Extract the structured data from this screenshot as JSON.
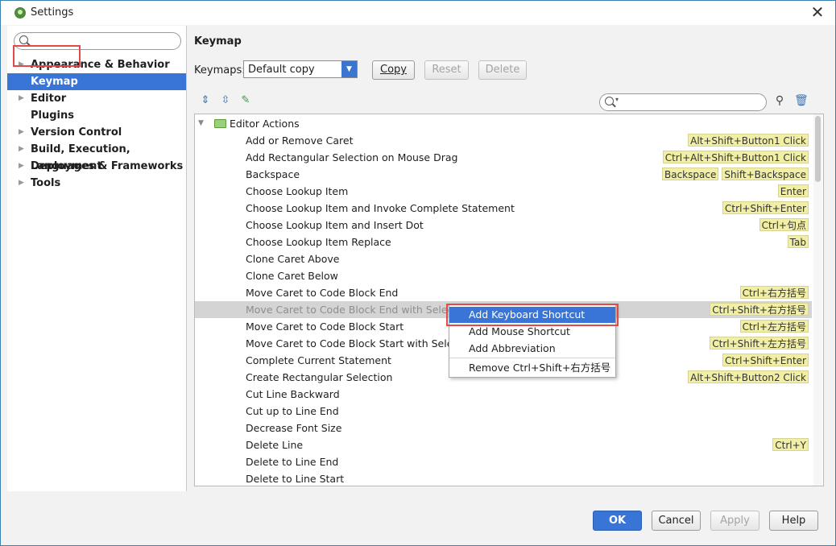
{
  "window": {
    "title": "Settings",
    "close_glyph": "✕"
  },
  "sidebar": {
    "search_placeholder": "",
    "items": [
      {
        "label": "Appearance & Behavior",
        "expandable": true
      },
      {
        "label": "Keymap",
        "expandable": false,
        "selected": true
      },
      {
        "label": "Editor",
        "expandable": true
      },
      {
        "label": "Plugins",
        "expandable": false
      },
      {
        "label": "Version Control",
        "expandable": true
      },
      {
        "label": "Build, Execution, Deployment",
        "expandable": true
      },
      {
        "label": "Languages & Frameworks",
        "expandable": true
      },
      {
        "label": "Tools",
        "expandable": true
      }
    ]
  },
  "main": {
    "heading": "Keymap",
    "keymaps_label": "Keymaps:",
    "keymap_value": "Default copy",
    "copy_label": "Copy",
    "reset_label": "Reset",
    "delete_label": "Delete",
    "search_placeholder": "",
    "tree": {
      "root_label": "Editor Actions",
      "rows": [
        {
          "name": "Add or Remove Caret",
          "shortcuts": [
            "Alt+Shift+Button1 Click"
          ]
        },
        {
          "name": "Add Rectangular Selection on Mouse Drag",
          "shortcuts": [
            "Ctrl+Alt+Shift+Button1 Click"
          ]
        },
        {
          "name": "Backspace",
          "shortcuts": [
            "Backspace",
            "Shift+Backspace"
          ]
        },
        {
          "name": "Choose Lookup Item",
          "shortcuts": [
            "Enter"
          ]
        },
        {
          "name": "Choose Lookup Item and Invoke Complete Statement",
          "shortcuts": [
            "Ctrl+Shift+Enter"
          ]
        },
        {
          "name": "Choose Lookup Item and Insert Dot",
          "shortcuts": [
            "Ctrl+句点"
          ]
        },
        {
          "name": "Choose Lookup Item Replace",
          "shortcuts": [
            "Tab"
          ]
        },
        {
          "name": "Clone Caret Above",
          "shortcuts": []
        },
        {
          "name": "Clone Caret Below",
          "shortcuts": []
        },
        {
          "name": "Move Caret to Code Block End",
          "shortcuts": [
            "Ctrl+右方括号"
          ]
        },
        {
          "name": "Move Caret to Code Block End with Selection",
          "shortcuts": [
            "Ctrl+Shift+右方括号"
          ],
          "highlighted": true
        },
        {
          "name": "Move Caret to Code Block Start",
          "shortcuts": [
            "Ctrl+左方括号"
          ]
        },
        {
          "name": "Move Caret to Code Block Start with Selection",
          "shortcuts": [
            "Ctrl+Shift+左方括号"
          ]
        },
        {
          "name": "Complete Current Statement",
          "shortcuts": [
            "Ctrl+Shift+Enter"
          ]
        },
        {
          "name": "Create Rectangular Selection",
          "shortcuts": [
            "Alt+Shift+Button2 Click"
          ]
        },
        {
          "name": "Cut Line Backward",
          "shortcuts": []
        },
        {
          "name": "Cut up to Line End",
          "shortcuts": []
        },
        {
          "name": "Decrease Font Size",
          "shortcuts": []
        },
        {
          "name": "Delete Line",
          "shortcuts": [
            "Ctrl+Y"
          ]
        },
        {
          "name": "Delete to Line End",
          "shortcuts": []
        },
        {
          "name": "Delete to Line Start",
          "shortcuts": []
        }
      ]
    },
    "context_menu": {
      "items": [
        "Add Keyboard Shortcut",
        "Add Mouse Shortcut",
        "Add Abbreviation",
        "Remove Ctrl+Shift+右方括号"
      ]
    }
  },
  "footer": {
    "ok_label": "OK",
    "cancel_label": "Cancel",
    "apply_label": "Apply",
    "help_label": "Help"
  },
  "colors": {
    "selection": "#3875d7",
    "highlight_marker": "#e04a4a",
    "shortcut_bg": "#f1eea5"
  }
}
